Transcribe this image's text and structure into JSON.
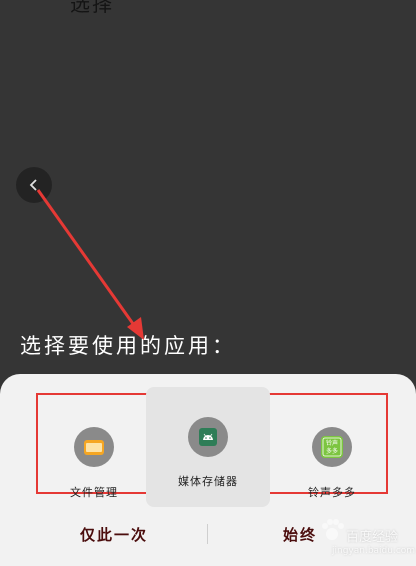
{
  "top_fragment": "选择",
  "back_button": {
    "icon": "chevron-left-icon"
  },
  "chooser": {
    "title": "选择要使用的应用："
  },
  "apps": [
    {
      "label": "文件管理",
      "icon": "folder-icon",
      "icon_color": "#f5a623",
      "selected": false
    },
    {
      "label": "媒体存储器",
      "icon": "android-icon",
      "icon_color": "#2e7d57",
      "selected": true
    },
    {
      "label": "铃声多多",
      "icon": "ringtone-app-icon",
      "icon_color": "#7cc540",
      "icon_text": "铃声多多",
      "selected": false
    }
  ],
  "actions": {
    "once_label": "仅此一次",
    "always_label": "始终"
  },
  "watermark": {
    "text": "百度经验",
    "url": "jingyan.baidu.com"
  },
  "colors": {
    "highlight": "#e53935",
    "background": "#353535",
    "sheet": "#f2f2f2"
  }
}
